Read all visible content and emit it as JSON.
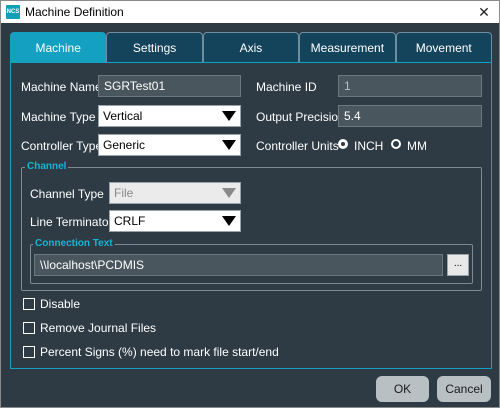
{
  "window": {
    "title": "Machine Definition",
    "app_icon_text": "NCS",
    "close_glyph": "✕"
  },
  "tabs": [
    {
      "label": "Machine",
      "active": true
    },
    {
      "label": "Settings",
      "active": false
    },
    {
      "label": "Axis",
      "active": false
    },
    {
      "label": "Measurement",
      "active": false
    },
    {
      "label": "Movement",
      "active": false
    }
  ],
  "machine": {
    "name_label": "Machine Name",
    "name_value": "SGRTest01",
    "id_label": "Machine ID",
    "id_value": "1",
    "type_label": "Machine Type",
    "type_value": "Vertical",
    "precision_label": "Output Precision",
    "precision_value": "5.4",
    "controller_type_label": "Controller Type",
    "controller_type_value": "Generic",
    "controller_units_label": "Controller Units",
    "units_option_inch": "INCH",
    "units_option_mm": "MM",
    "units_selected": "INCH"
  },
  "channel": {
    "group_title": "Channel",
    "type_label": "Channel Type",
    "type_value": "File",
    "terminator_label": "Line Terminator",
    "terminator_value": "CRLF",
    "connection_group_title": "Connection Text",
    "connection_value": "\\\\localhost\\PCDMIS",
    "browse_label": "..."
  },
  "options": {
    "disable_label": "Disable",
    "remove_journal_label": "Remove Journal Files",
    "percent_signs_label": "Percent Signs (%) need to mark file start/end",
    "disable_checked": false,
    "remove_journal_checked": false,
    "percent_signs_checked": false
  },
  "footer": {
    "ok_label": "OK",
    "cancel_label": "Cancel"
  },
  "colors": {
    "background": "#2e3b44",
    "tab_active": "#14a0c0",
    "tab_inactive": "#14445c",
    "group_title": "#14b4d6"
  }
}
